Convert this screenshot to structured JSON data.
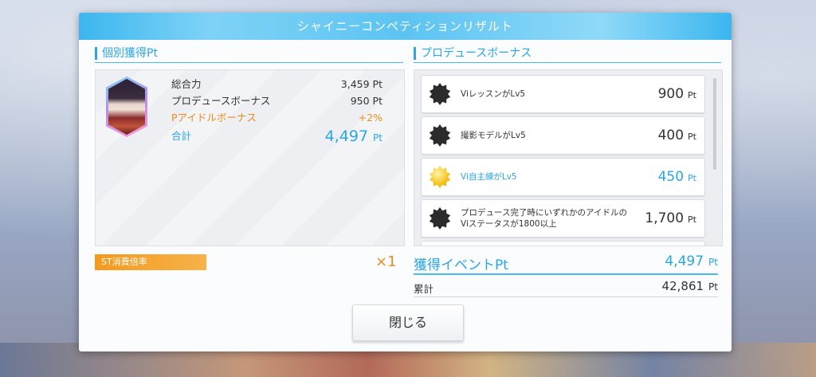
{
  "dialog": {
    "title": "シャイニーコンペティションリザルト"
  },
  "individual": {
    "header": "個別獲得Pt",
    "rows": {
      "total_power": {
        "label": "総合力",
        "value": "3,459",
        "unit": "Pt"
      },
      "produce_bonus": {
        "label": "プロデュースボーナス",
        "value": "950",
        "unit": "Pt"
      },
      "idol_bonus": {
        "label": "Pアイドルボーナス",
        "value": "+2%"
      },
      "sum": {
        "label": "合計",
        "value": "4,497",
        "unit": "Pt"
      }
    }
  },
  "produce_bonus": {
    "header": "プロデュースボーナス",
    "items": [
      {
        "line1": "ViレッスンがLv5",
        "line2": "",
        "value": "900",
        "unit": "Pt",
        "badge": "black-star-badge"
      },
      {
        "line1": "撮影モデルがLv5",
        "line2": "",
        "value": "400",
        "unit": "Pt",
        "badge": "black-star-badge"
      },
      {
        "line1": "Vi自主練がLv5",
        "line2": "",
        "value": "450",
        "unit": "Pt",
        "badge": "gold-star-badge"
      },
      {
        "line1": "プロデュース完了時にいずれかのアイドルの",
        "line2": "Viステータスが1800以上",
        "value": "1,700",
        "unit": "Pt",
        "badge": "black-star-badge"
      }
    ]
  },
  "st": {
    "label": "ST消費倍率",
    "multiplier": "×1"
  },
  "event": {
    "label": "獲得イベントPt",
    "value": "4,497",
    "unit": "Pt"
  },
  "cumulative": {
    "label": "累計",
    "value": "42,861",
    "unit": "Pt"
  },
  "close_button": "閉じる",
  "colors": {
    "accent_blue": "#2aa6e6",
    "accent_orange": "#f08a1c",
    "gold_badge": "#f4c21c"
  }
}
